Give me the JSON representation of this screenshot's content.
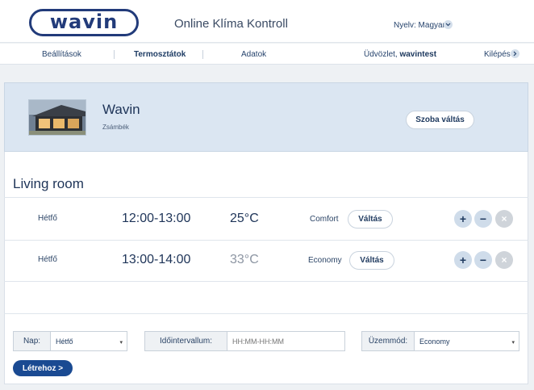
{
  "header": {
    "logo_text": "wavin",
    "app_title": "Online Klíma Kontroll",
    "language_label": "Nyelv: Magyar"
  },
  "nav": {
    "settings": "Beállítások",
    "thermostats": "Termosztátok",
    "data": "Adatok",
    "greeting": "Üdvözlet, ",
    "username": "wavintest",
    "logout": "Kilépés"
  },
  "room": {
    "name": "Wavin",
    "location": "Zsámbék",
    "switch_label": "Szoba váltás"
  },
  "section_title": "Living room",
  "schedule": [
    {
      "day": "Hétfő",
      "time": "12:00-13:00",
      "temp": "25°C",
      "temp_color": "#1e3458",
      "mode": "Comfort",
      "switch": "Váltás"
    },
    {
      "day": "Hétfő",
      "time": "13:00-14:00",
      "temp": "33°C",
      "temp_color": "#8d96a3",
      "mode": "Economy",
      "switch": "Váltás"
    }
  ],
  "controls": {
    "plus": "+",
    "minus": "−",
    "remove": "×"
  },
  "form": {
    "day_label": "Nap:",
    "day_value": "Hétfő",
    "interval_label": "Időintervallum:",
    "interval_placeholder": "HH:MM-HH:MM",
    "mode_label": "Üzemmód:",
    "mode_value": "Economy",
    "create_label": "Létrehoz  >"
  },
  "colors": {
    "accent": "#1a4a92",
    "logo": "#223b7a",
    "band": "#dbe6f2"
  }
}
